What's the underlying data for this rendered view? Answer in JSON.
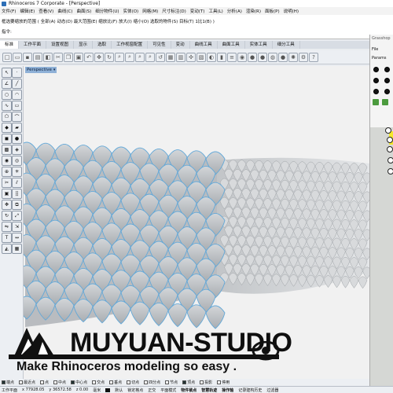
{
  "window": {
    "title": "Rhinoceros 7 Corporate - [Perspective]"
  },
  "menu": [
    "文件(F)",
    "编辑(E)",
    "查看(V)",
    "曲线(C)",
    "曲面(S)",
    "细分物件(U)",
    "实体(O)",
    "网格(M)",
    "尺寸标注(D)",
    "变动(T)",
    "工具(L)",
    "分析(A)",
    "渲染(R)",
    "面板(P)",
    "说明(H)"
  ],
  "command": {
    "history": "框选要缩放的范围 ( 全部(A)  动态(D)  最大范围(E)  缩放比(F)  放大(I)  缩小(O)  选取的物件(S)  目标(T)  1比1(B) )",
    "prompt": "指令:",
    "input_value": ""
  },
  "tabs": [
    "标准",
    "工作平面",
    "设置视图",
    "显示",
    "选取",
    "工作视窗配置",
    "可见性",
    "变动",
    "曲线工具",
    "曲面工具",
    "实体工具",
    "细分工具"
  ],
  "active_tab": 0,
  "viewport": {
    "label": "Perspective"
  },
  "grasshopper": {
    "title": "Grasshop",
    "file_menu": "File",
    "params_tab": "Params"
  },
  "logo": {
    "name": "MUYUAN-STUDIO",
    "slogan": "Make Rhinoceros modeling so easy ."
  },
  "osnaps": [
    {
      "label": "端点",
      "checked": true
    },
    {
      "label": "最近点",
      "checked": false
    },
    {
      "label": "点",
      "checked": false
    },
    {
      "label": "中点",
      "checked": false
    },
    {
      "label": "中心点",
      "checked": true
    },
    {
      "label": "交点",
      "checked": false
    },
    {
      "label": "垂点",
      "checked": false
    },
    {
      "label": "切点",
      "checked": false
    },
    {
      "label": "四分点",
      "checked": false
    },
    {
      "label": "节点",
      "checked": false
    },
    {
      "label": "顶点",
      "checked": true
    },
    {
      "label": "投影",
      "checked": false
    },
    {
      "label": "停用",
      "checked": false
    }
  ],
  "status": {
    "plane": "工作平面",
    "x": "x 77928.05",
    "y": "y 36572.58",
    "z": "z 0.00",
    "unit": "毫米",
    "layer": "默认",
    "items": [
      "锁定格点",
      "正交",
      "平面模式",
      "物件锁点",
      "智慧轨迹",
      "操作轴",
      "记录建构历史",
      "过滤器"
    ]
  },
  "colors": {
    "scale_shade": "#a9adb1",
    "scale_edge": "#62a8d8",
    "viewport_bg": "#f1f1f1"
  }
}
